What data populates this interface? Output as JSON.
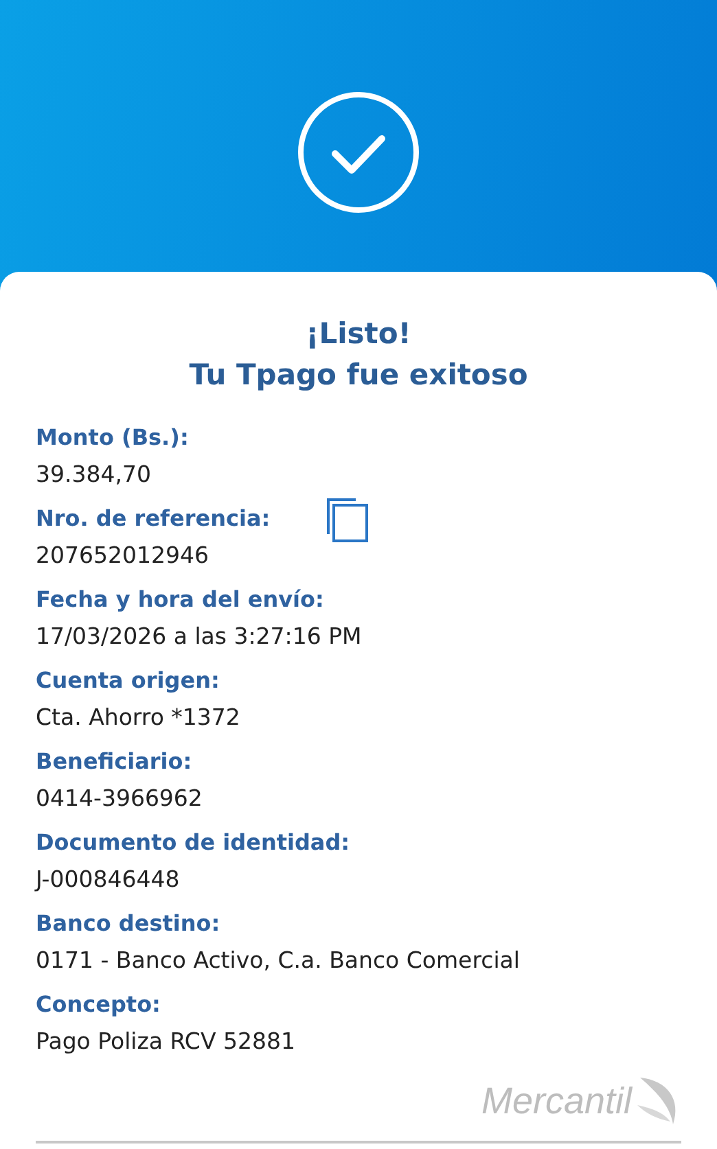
{
  "title": [
    "¡Listo!",
    "Tu Tpago fue exitoso"
  ],
  "fields": [
    {
      "label": "Monto (Bs.):",
      "value": "39.384,70",
      "copyable": false
    },
    {
      "label": "Nro. de referencia:",
      "value": "207652012946",
      "copyable": true
    },
    {
      "label": "Fecha y hora del envío:",
      "value": "17/03/2026 a las 3:27:16 PM",
      "copyable": false
    },
    {
      "label": "Cuenta origen:",
      "value": "Cta. Ahorro *1372",
      "copyable": false
    },
    {
      "label": "Beneficiario:",
      "value": "0414-3966962",
      "copyable": false
    },
    {
      "label": "Documento de identidad:",
      "value": "J-000846448",
      "copyable": false
    },
    {
      "label": "Banco destino:",
      "value": "0171 - Banco Activo, C.a. Banco Comercial",
      "copyable": false
    },
    {
      "label": "Concepto:",
      "value": "Pago Poliza RCV 52881",
      "copyable": false
    }
  ],
  "brand": "Mercantil"
}
